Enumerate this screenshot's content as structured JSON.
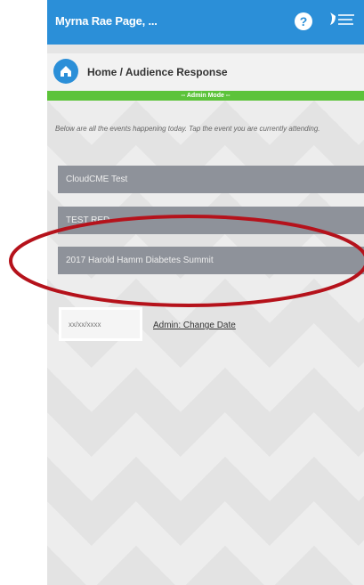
{
  "header": {
    "user_name": "Myrna Rae Page, ...",
    "help_icon_glyph": "?",
    "logo_icon": "institution-logo"
  },
  "breadcrumb": {
    "text": "Home / Audience Response",
    "icon": "home-icon"
  },
  "admin_banner": {
    "text": "-- Admin Mode --"
  },
  "intro_text": "Below are all the events happening today. Tap the event you are currently attending.",
  "events": [
    {
      "label": "CloudCME Test"
    },
    {
      "label": "TEST RED"
    },
    {
      "label": "2017 Harold Hamm Diabetes Summit"
    }
  ],
  "date_input": {
    "placeholder": "xx/xx/xxxx"
  },
  "admin_change_date_label": "Admin: Change Date",
  "colors": {
    "header_blue": "#2b8fd8",
    "admin_green": "#5cc33a",
    "event_gray": "#8e929a",
    "highlight_red": "#b5121b"
  }
}
